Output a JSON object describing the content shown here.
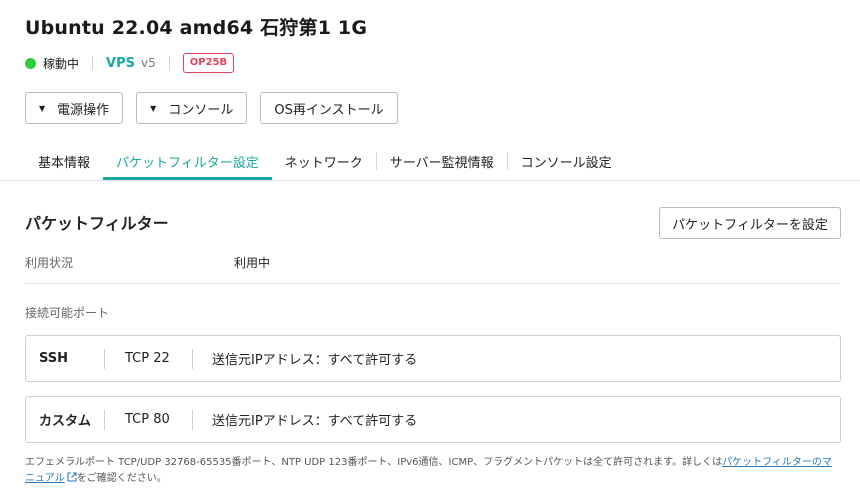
{
  "header": {
    "title": "Ubuntu 22.04 amd64 石狩第1 1G",
    "status_text": "稼動中",
    "status_color": "#2ecc40",
    "service": "VPS",
    "version": "v5",
    "badge": "OP25B",
    "badge_color": "#e0455c"
  },
  "actions": {
    "power": "電源操作",
    "console": "コンソール",
    "reinstall": "OS再インストール"
  },
  "tabs": [
    {
      "label": "基本情報",
      "active": false
    },
    {
      "label": "パケットフィルター設定",
      "active": true
    },
    {
      "label": "ネットワーク",
      "active": false
    },
    {
      "label": "サーバー監視情報",
      "active": false
    },
    {
      "label": "コンソール設定",
      "active": false
    }
  ],
  "accent_color": "#1aa8a0",
  "packet_filter": {
    "title": "パケットフィルター",
    "set_button": "パケットフィルターを設定",
    "usage_label": "利用状況",
    "usage_value": "利用中",
    "ports_label": "接続可能ポート",
    "ports": [
      {
        "name": "SSH",
        "protocol": "TCP 22",
        "source": "送信元IPアドレス：すべて許可する"
      },
      {
        "name": "カスタム",
        "protocol": "TCP 80",
        "source": "送信元IPアドレス：すべて許可する"
      }
    ]
  },
  "footnote": {
    "text": "エフェメラルポート TCP/UDP 32768-65535番ポート、NTP UDP 123番ポート、IPv6通信、ICMP、フラグメントパケットは全て許可されます。詳しくは",
    "link": "パケットフィルターのマニュアル",
    "suffix": "をご確認ください。",
    "link_color": "#2a7ac0",
    "link_icon": "external-link-icon"
  }
}
